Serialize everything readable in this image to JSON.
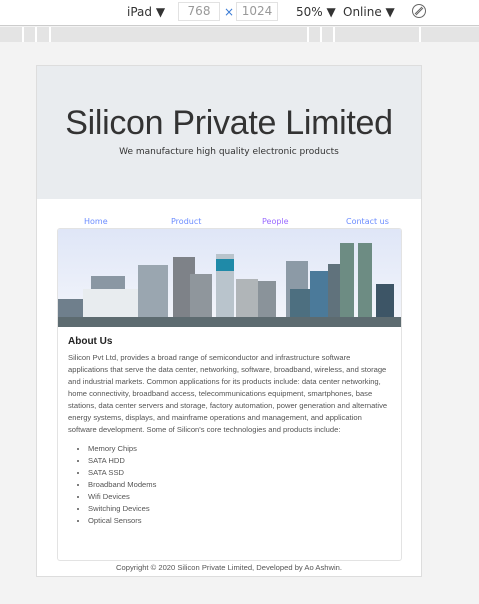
{
  "devtools": {
    "device": "iPad",
    "width": "768",
    "height": "1024",
    "times": "×",
    "zoom": "50%",
    "network": "Online"
  },
  "jumbotron": {
    "title": "Silicon Private Limited",
    "subtitle": "We manufacture high quality electronic products"
  },
  "nav": [
    "Home",
    "Product",
    "People",
    "Contact us"
  ],
  "nav_color": "#6b8cff",
  "about": {
    "heading": "About Us",
    "text": "Silicon Pvt Ltd, provides a broad range of semiconductor and infrastructure software applications that serve the data center, networking, software, broadband, wireless, and storage and industrial markets. Common applications for its products include: data center networking, home connectivity, broadband access, telecommunications equipment, smartphones, base stations, data center servers and storage, factory automation, power generation and alternative energy systems, displays, and mainframe operations and management, and application software development. Some of Silicon's core technologies and products include:",
    "products": [
      "Memory Chips",
      "SATA HDD",
      "SATA SSD",
      "Broadband Modems",
      "Wifi Devices",
      "Switching Devices",
      "Optical Sensors"
    ]
  },
  "footer": "Copyright © 2020 Silicon Private Limited, Developed by Ao Ashwin."
}
